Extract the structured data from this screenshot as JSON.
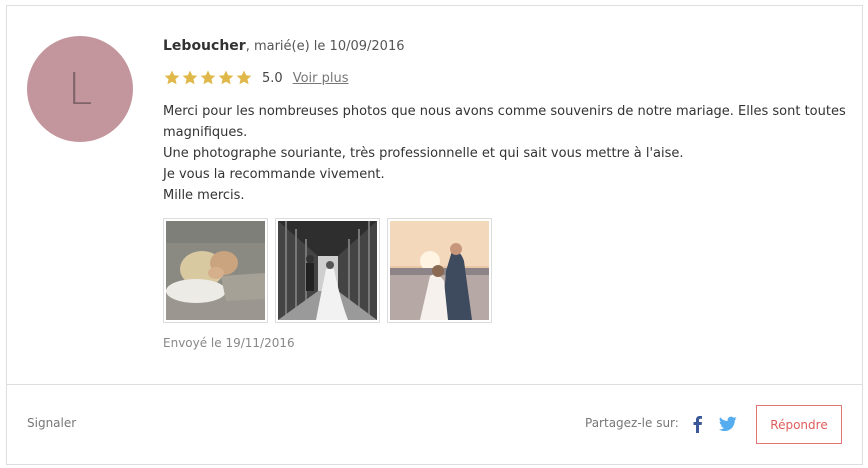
{
  "review": {
    "avatar_letter": "L",
    "author": "Leboucher",
    "married_text": ", marié(e) le 10/09/2016",
    "rating": {
      "stars": 5,
      "max": 5,
      "score": "5.0",
      "color": "#e0b84a"
    },
    "voir_plus": "Voir plus",
    "text_lines": [
      "Merci pour les nombreuses photos que nous avons comme souvenirs de notre mariage. Elles sont toutes magnifiques.",
      "Une photographe souriante, très professionnelle et qui sait vous mettre à l'aise.",
      "Je vous la recommande vivement.",
      "Mille mercis."
    ],
    "sent": "Envoyé le 19/11/2016"
  },
  "footer": {
    "signaler": "Signaler",
    "share_label": "Partagez-le sur:",
    "repondre": "Répondre"
  },
  "icons": [
    "star-icon",
    "facebook-icon",
    "twitter-icon"
  ],
  "colors": {
    "avatar": "#c3969e",
    "accent": "#e05c5c",
    "star": "#e0b84a",
    "facebook": "#3b5998",
    "twitter": "#55acee"
  }
}
